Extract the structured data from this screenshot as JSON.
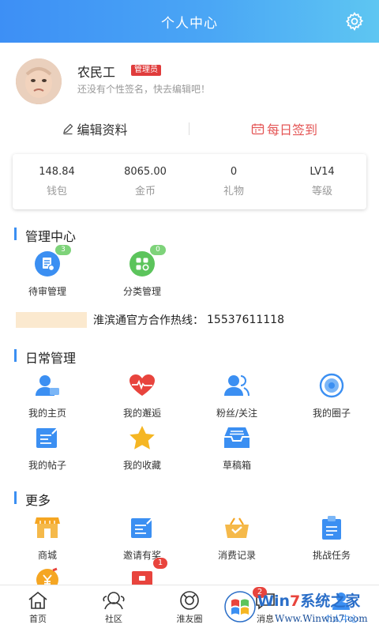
{
  "header": {
    "title": "个人中心"
  },
  "profile": {
    "username": "农民工",
    "role": "管理员",
    "signature": "还没有个性签名，快去编辑吧！"
  },
  "actions": {
    "edit": "编辑资料",
    "sign_in": "每日签到"
  },
  "stats": [
    {
      "value": "148.84",
      "label": "钱包"
    },
    {
      "value": "8065.00",
      "label": "金币"
    },
    {
      "value": "0",
      "label": "礼物"
    },
    {
      "value": "LV14",
      "label": "等级"
    }
  ],
  "admin": {
    "title": "管理中心",
    "items": [
      {
        "label": "待审管理",
        "badge": "3",
        "icon": "doc-review-icon"
      },
      {
        "label": "分类管理",
        "badge": "0",
        "icon": "category-icon"
      }
    ]
  },
  "hotline": {
    "text": "淮滨通官方合作热线：",
    "number": "15537611118"
  },
  "daily": {
    "title": "日常管理",
    "items": [
      {
        "label": "我的主页",
        "icon": "user-card-icon"
      },
      {
        "label": "我的邂逅",
        "icon": "heartbeat-icon"
      },
      {
        "label": "粉丝/关注",
        "icon": "fans-icon"
      },
      {
        "label": "我的圈子",
        "icon": "circle-target-icon"
      },
      {
        "label": "我的帖子",
        "icon": "post-edit-icon"
      },
      {
        "label": "我的收藏",
        "icon": "star-icon"
      },
      {
        "label": "草稿箱",
        "icon": "drafts-tray-icon"
      }
    ]
  },
  "more": {
    "title": "更多",
    "items": [
      {
        "label": "商城",
        "icon": "shop-icon"
      },
      {
        "label": "邀请有奖",
        "icon": "invite-icon"
      },
      {
        "label": "消费记录",
        "icon": "basket-icon"
      },
      {
        "label": "挑战任务",
        "icon": "clipboard-icon"
      }
    ],
    "extra_badge": "1"
  },
  "tabbar": {
    "items": [
      {
        "label": "首页",
        "icon": "home-icon"
      },
      {
        "label": "社区",
        "icon": "community-icon"
      },
      {
        "label": "淮友圈",
        "icon": "camera-circle-icon"
      },
      {
        "label": "消息",
        "icon": "message-icon",
        "badge": "2"
      },
      {
        "label": "个人中心",
        "icon": "profile-icon"
      }
    ]
  },
  "watermark": {
    "brand_prefix": "Win",
    "brand_seven": "7",
    "brand_suffix": "系统之家",
    "url": "Www.Winwin7.com"
  },
  "colors": {
    "accent": "#3b8ff2",
    "signin_red": "#e45656",
    "badge_green": "#7ed37a",
    "badge_red": "#e8443d"
  }
}
